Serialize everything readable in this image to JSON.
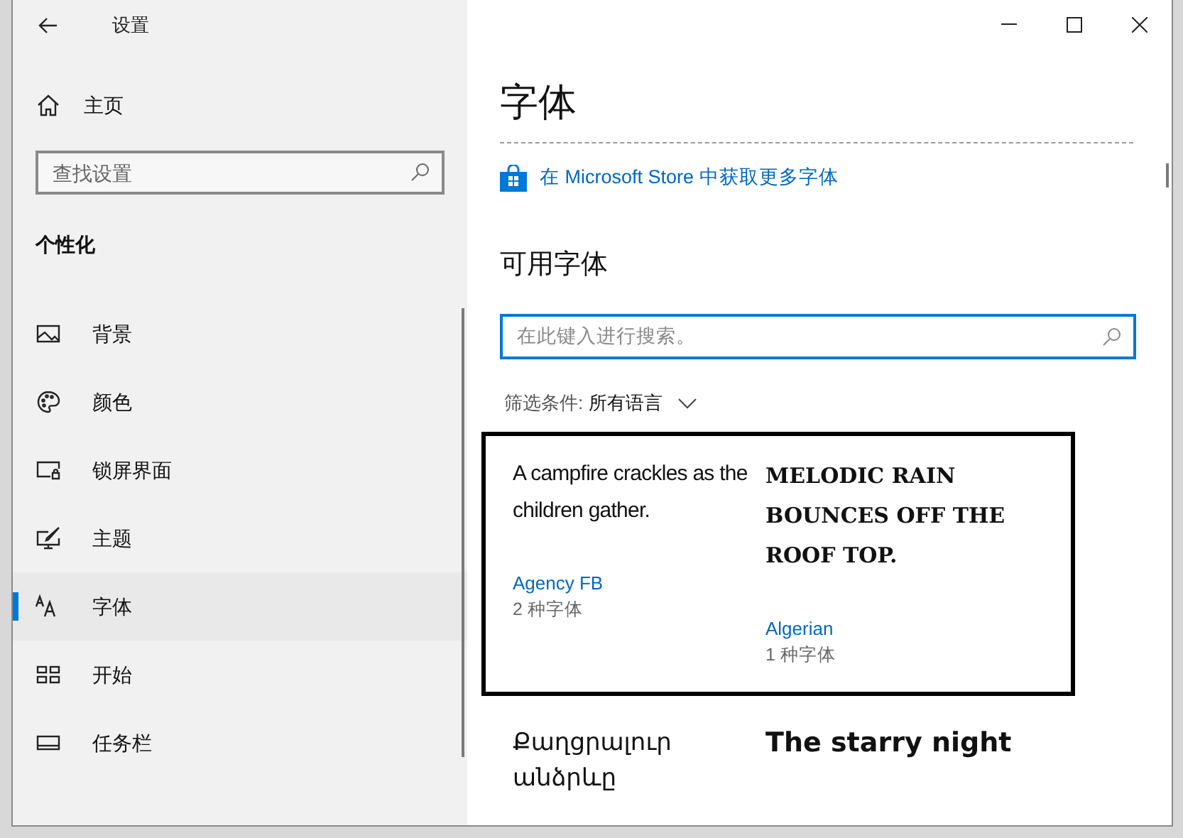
{
  "window": {
    "title": "设置"
  },
  "sidebar": {
    "home": "主页",
    "search": {
      "placeholder": "查找设置"
    },
    "section": "个性化",
    "items": [
      {
        "kind": "background",
        "label": "背景",
        "selected": false
      },
      {
        "kind": "colors",
        "label": "颜色",
        "selected": false
      },
      {
        "kind": "lockscreen",
        "label": "锁屏界面",
        "selected": false
      },
      {
        "kind": "themes",
        "label": "主题",
        "selected": false
      },
      {
        "kind": "fonts",
        "label": "字体",
        "selected": true
      },
      {
        "kind": "start",
        "label": "开始",
        "selected": false
      },
      {
        "kind": "taskbar",
        "label": "任务栏",
        "selected": false
      }
    ]
  },
  "page": {
    "title": "字体",
    "store_link": "在 Microsoft Store 中获取更多字体",
    "section": "可用字体",
    "search": {
      "placeholder": "在此键入进行搜索。"
    },
    "filter": {
      "label": "筛选条件:",
      "value": "所有语言"
    },
    "fonts": [
      {
        "kind": "condensed",
        "sample": "A campfire crackles as the children gather.",
        "name": "Agency FB",
        "count": "2 种字体",
        "selected": true
      },
      {
        "kind": "decorative",
        "sample": "MELODIC RAIN BOUNCES OFF THE ROOF TOP.",
        "name": "Algerian",
        "count": "1 种字体",
        "selected": true
      },
      {
        "kind": "plain",
        "sample": "Քաղցրալուր անձրևը",
        "selected": false
      },
      {
        "kind": "bold",
        "sample": "The starry night",
        "selected": false
      }
    ]
  }
}
